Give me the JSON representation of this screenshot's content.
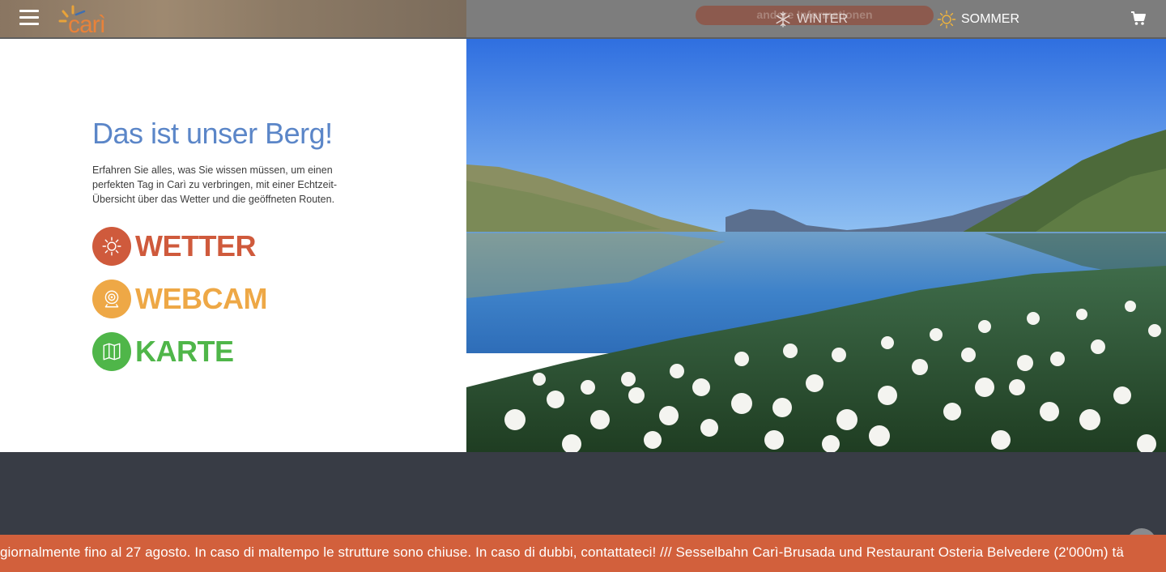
{
  "header": {
    "logo_text": "carì",
    "more_info_label": "andere Informationen",
    "winter_label": "WINTER",
    "summer_label": "SOMMER",
    "icons": [
      "menu-icon",
      "snowflake-icon",
      "sun-icon",
      "cart-icon"
    ]
  },
  "main": {
    "title": "Das ist unser Berg!",
    "description": "Erfahren Sie alles, was Sie wissen müssen, um einen perfekten Tag in Carì zu verbringen, mit einer Echtzeit-Übersicht über das Wetter und die geöffneten Routen.",
    "links": [
      {
        "label": "WETTER",
        "icon": "sun-icon",
        "color": "#cf5a3c"
      },
      {
        "label": "WEBCAM",
        "icon": "webcam-icon",
        "color": "#eea846"
      },
      {
        "label": "KARTE",
        "icon": "map-icon",
        "color": "#4fb649"
      }
    ]
  },
  "ticker": {
    "text": "giornalmente fino al 27 agosto. In caso di maltempo le strutture sono chiuse. In caso di dubbi, contattateci! /// Sesselbahn Carì-Brusada und Restaurant Osteria Belvedere (2'000m) tä"
  },
  "colors": {
    "title_blue": "#5b86c8",
    "ticker_orange": "#d2603c",
    "dark_band": "#383c45"
  }
}
